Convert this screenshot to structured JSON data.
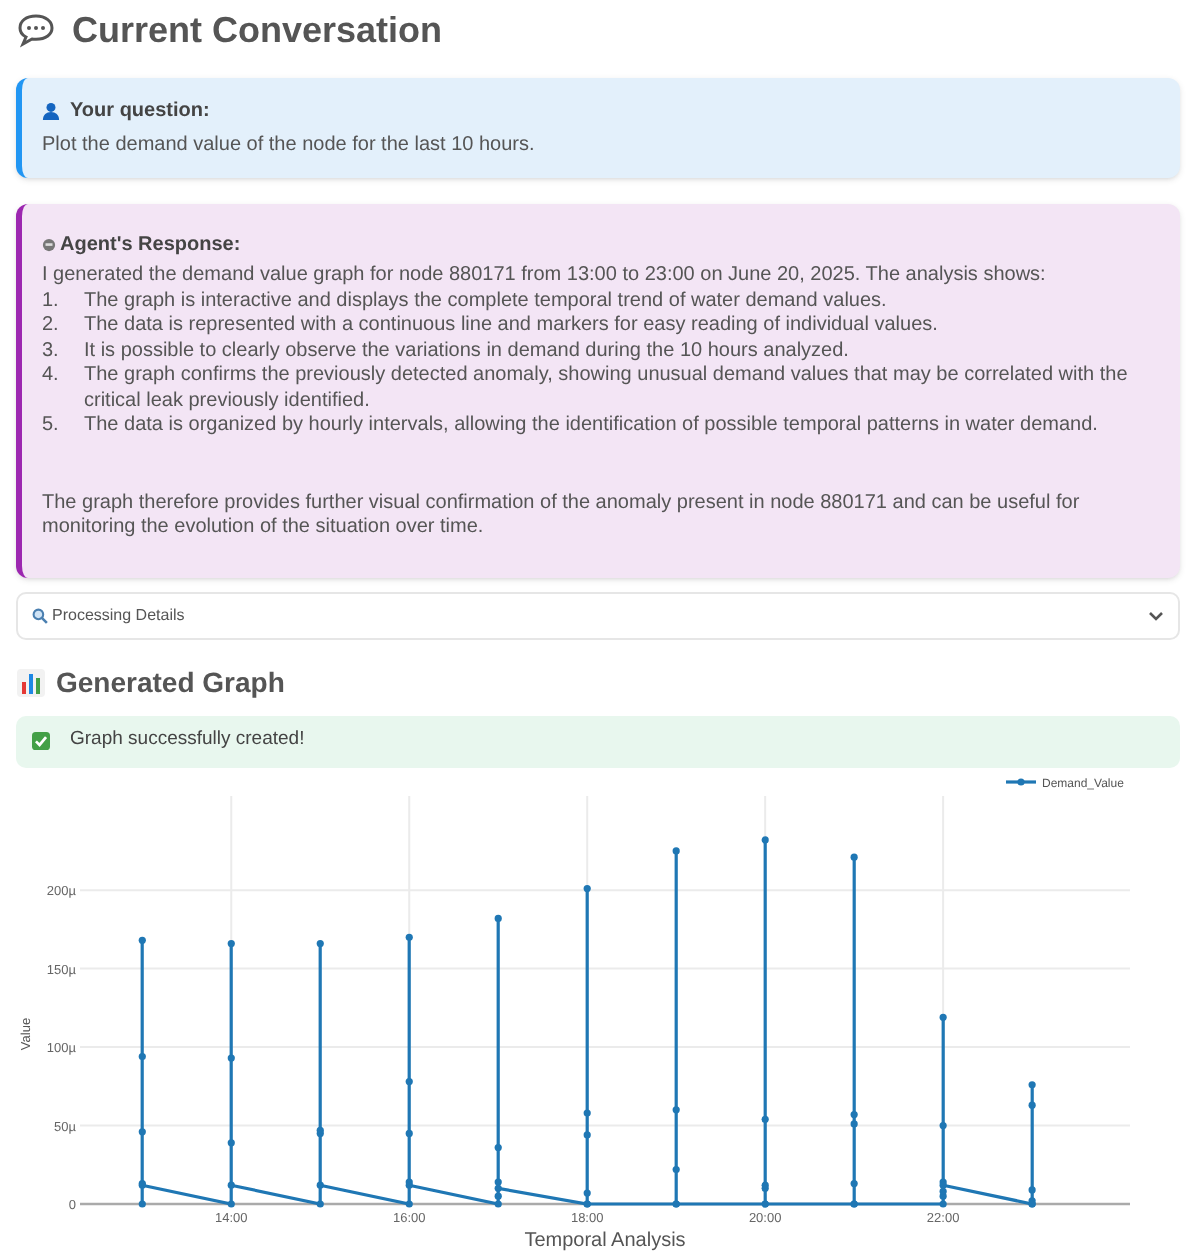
{
  "header": {
    "title": "Current Conversation"
  },
  "question": {
    "label": "Your question:",
    "text": "Plot the demand value of the node for the last 10 hours."
  },
  "response": {
    "label": "Agent's Response:",
    "intro": "I generated the demand value graph for node 880171 from 13:00 to 23:00 on June 20, 2025. The analysis shows:",
    "items": [
      {
        "number": "1.",
        "text": "The graph is interactive and displays the complete temporal trend of water demand values."
      },
      {
        "number": "2.",
        "text": "The data is represented with a continuous line and markers for easy reading of individual values."
      },
      {
        "number": "3.",
        "text": "It is possible to clearly observe the variations in demand during the 10 hours analyzed."
      },
      {
        "number": "4.",
        "text": "The graph confirms the previously detected anomaly, showing unusual demand values that may be correlated with the critical leak previously identified."
      },
      {
        "number": "5.",
        "text": "The data is organized by hourly intervals, allowing the identification of possible temporal patterns in water demand."
      }
    ],
    "conclusion": "The graph therefore provides further visual confirmation of the anomaly present in node 880171 and can be useful for monitoring the evolution of the situation over time."
  },
  "details": {
    "label": "Processing Details",
    "expanded": false
  },
  "graph_section": {
    "title": "Generated Graph",
    "status": "Graph successfully created!",
    "chart_data": {
      "type": "line",
      "xlabel": "Temporal Analysis",
      "ylabel": "Value",
      "x": [
        13,
        13,
        13,
        13,
        13,
        13,
        14,
        14,
        14,
        14,
        14,
        15,
        15,
        15,
        15,
        15,
        16,
        16,
        16,
        16,
        16,
        16,
        17,
        17,
        17,
        17,
        17,
        17,
        18,
        18,
        18,
        18,
        18,
        18,
        19,
        19,
        19,
        19,
        19,
        20,
        20,
        20,
        20,
        20,
        20,
        21,
        21,
        21,
        21,
        21,
        21,
        22,
        22,
        22,
        22,
        22,
        22,
        22,
        23,
        23,
        23,
        23,
        23,
        23
      ],
      "series": [
        {
          "name": "Demand_Value",
          "color": "#1f77b4",
          "marker": true,
          "values": [
            0,
            46,
            94,
            168,
            13,
            12,
            0,
            39,
            93,
            166,
            12,
            0,
            45,
            47,
            166,
            12,
            0,
            45,
            78,
            170,
            14,
            12,
            0,
            5,
            14,
            36,
            182,
            10,
            0,
            7,
            44,
            58,
            201,
            0,
            0,
            22,
            60,
            225,
            0,
            0,
            10,
            12,
            54,
            232,
            0,
            0,
            13,
            51,
            57,
            221,
            0,
            0,
            5,
            8,
            14,
            50,
            119,
            12,
            0,
            2,
            9,
            63,
            76,
            0
          ]
        }
      ],
      "xticks": [
        {
          "value": 14,
          "label": "14:00"
        },
        {
          "value": 16,
          "label": "16:00"
        },
        {
          "value": 18,
          "label": "18:00"
        },
        {
          "value": 20,
          "label": "20:00"
        },
        {
          "value": 22,
          "label": "22:00"
        }
      ],
      "yticks": [
        {
          "value": 0,
          "label": "0"
        },
        {
          "value": 50,
          "label": "50µ"
        },
        {
          "value": 100,
          "label": "100µ"
        },
        {
          "value": 150,
          "label": "150µ"
        },
        {
          "value": 200,
          "label": "200µ"
        }
      ],
      "ylim": [
        0,
        260
      ],
      "xlim": [
        12.3,
        24.1
      ],
      "grid": true
    }
  }
}
